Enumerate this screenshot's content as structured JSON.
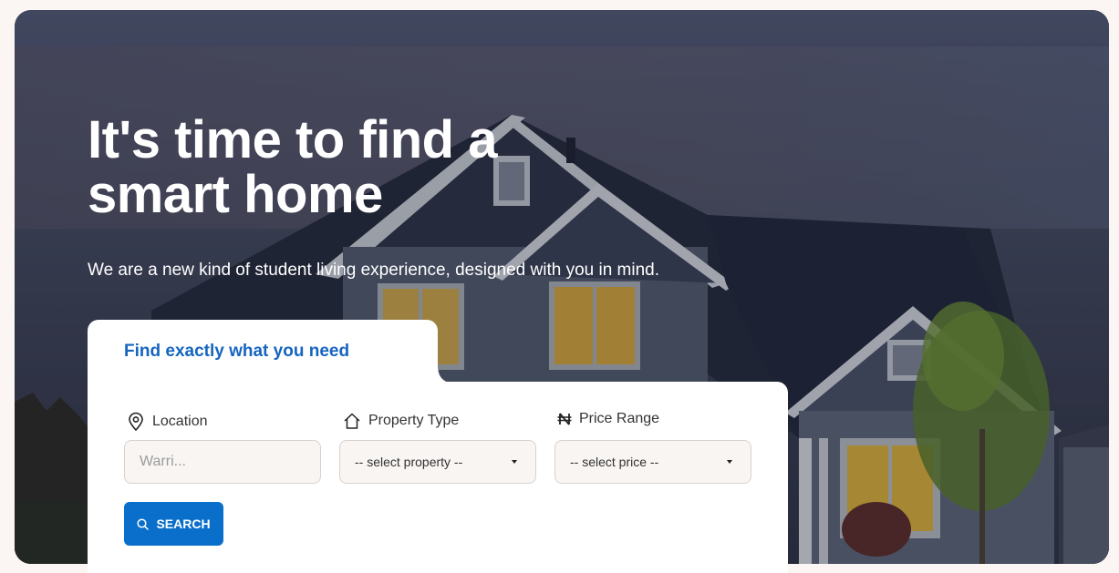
{
  "hero": {
    "title_line1": "It's time to find a",
    "title_line2": "smart home",
    "subtitle": "We are a new kind of student living experience, designed with you in mind."
  },
  "search_card": {
    "title": "Find exactly what you need",
    "location": {
      "label": "Location",
      "placeholder": "Warri...",
      "icon": "location-pin-icon"
    },
    "property_type": {
      "label": "Property Type",
      "selected": "-- select property --",
      "icon": "house-icon"
    },
    "price_range": {
      "label": "Price Range",
      "selected": "-- select price --",
      "icon": "naira-icon"
    },
    "search_button": {
      "label": "SEARCH",
      "icon": "search-icon"
    }
  },
  "colors": {
    "accent": "#1565c0",
    "button": "#0a6fcb",
    "card_bg": "#ffffff",
    "page_bg": "#fbf6f3"
  }
}
